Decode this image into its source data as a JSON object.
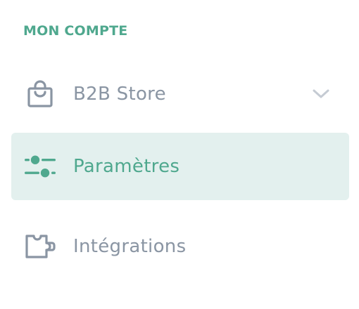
{
  "section": {
    "title": "MON COMPTE"
  },
  "nav": {
    "items": [
      {
        "label": "B2B Store",
        "icon": "shopping-bag-icon",
        "has_submenu": true,
        "active": false
      },
      {
        "label": "Paramètres",
        "icon": "sliders-icon",
        "active": true
      },
      {
        "label": "Intégrations",
        "icon": "puzzle-icon",
        "active": false
      }
    ]
  },
  "colors": {
    "accent": "#4fa88e",
    "active_background": "#e3f0ee",
    "muted_text": "#8a95a3",
    "chevron": "#c5cbd3"
  }
}
